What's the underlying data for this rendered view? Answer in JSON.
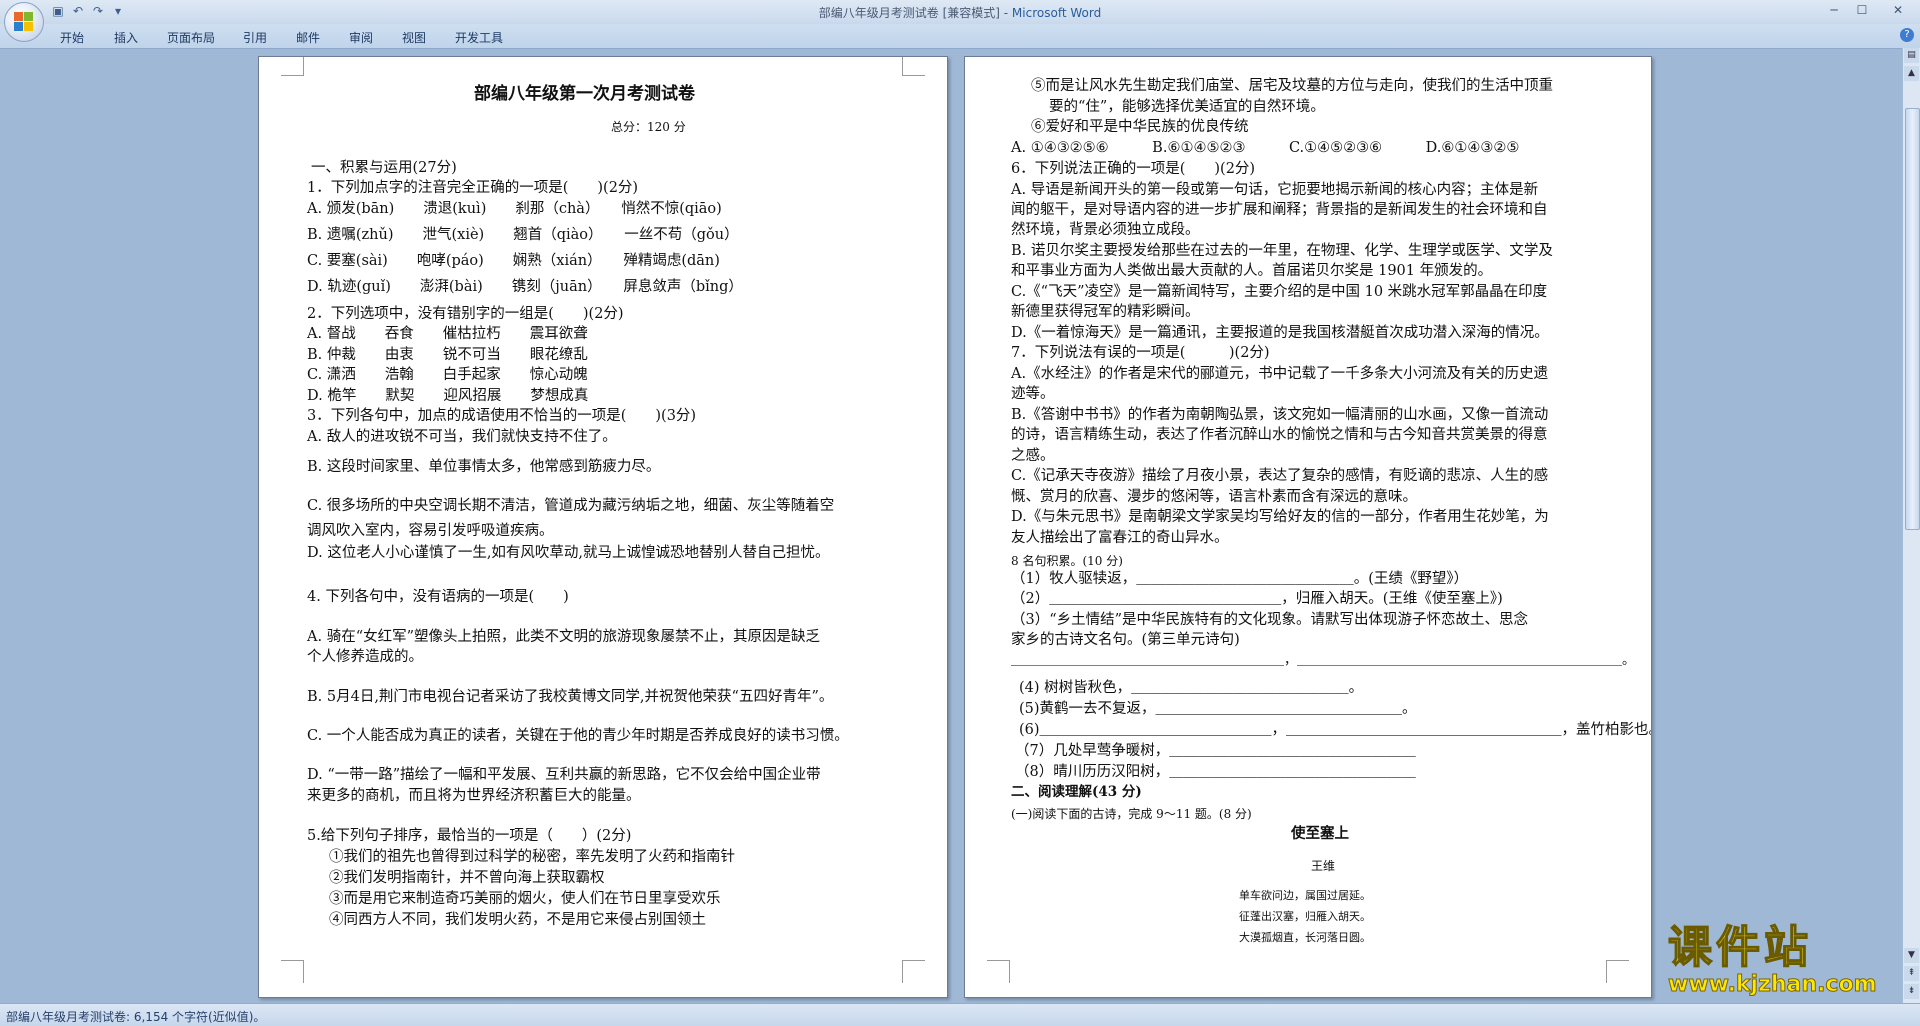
{
  "window": {
    "title_doc": "部编八年级月考测试卷 [兼容模式] - ",
    "title_app": "Microsoft Word"
  },
  "ribbon": {
    "tabs": [
      "开始",
      "插入",
      "页面布局",
      "引用",
      "邮件",
      "审阅",
      "视图",
      "开发工具"
    ]
  },
  "page1": {
    "lines": [
      "部编八年级第一次月考测试卷",
      "总分：120 分",
      "一、积累与运用(27分)",
      "1．下列加点字的注音完全正确的一项是(　　)(2分)",
      "A. 颁发(bān)　　溃退(kuì)　　刹那（chà）　　悄然不惊(qiāo)",
      "B. 遗嘱(zhǔ)　　泄气(xiè)　　翘首（qiào）　　一丝不苟（gǒu）",
      "C. 要塞(sài)　　咆哮(páo)　　娴熟（xián）　　殚精竭虑(dān)",
      "D. 轨迹(guǐ)　　澎湃(bài)　　镌刻（juān）　　屏息敛声（bǐng）",
      "2．下列选项中，没有错别字的一组是(　　)(2分)",
      "A. 督战　　吞食　　催枯拉朽　　震耳欲聋",
      "B. 仲裁　　由衷　　锐不可当　　眼花缭乱",
      "C. 潇洒　　浩翰　　白手起家　　惊心动魄",
      "D. 桅竿　　默契　　迎风招展　　梦想成真",
      "3．下列各句中，加点的成语使用不恰当的一项是(　　)(3分)",
      "A. 敌人的进攻锐不可当，我们就快支持不住了。",
      "B. 这段时间家里、单位事情太多，他常感到筋疲力尽。",
      "C. 很多场所的中央空调长期不清洁，管道成为藏污纳垢之地，细菌、灰尘等随着空",
      "调风吹入室内，容易引发呼吸道疾病。",
      "D. 这位老人小心谨慎了一生,如有风吹草动,就马上诚惶诚恐地替别人替自己担忧。",
      "4. 下列各句中，没有语病的一项是(　　)",
      "A. 骑在“女红军”塑像头上拍照，此类不文明的旅游现象屡禁不止，其原因是缺乏",
      "个人修养造成的。",
      "B. 5月4日,荆门市电视台记者采访了我校黄博文同学,并祝贺他荣获“五四好青年”。",
      "C. 一个人能否成为真正的读者，关键在于他的青少年时期是否养成良好的读书习惯。",
      "D. “一带一路”描绘了一幅和平发展、互利共赢的新思路，它不仅会给中国企业带",
      "来更多的商机，而且将为世界经济积蓄巨大的能量。",
      "5.给下列句子排序，最恰当的一项是（　　）(2分)",
      "①我们的祖先也曾得到过科学的秘密，率先发明了火药和指南针",
      "②我们发明指南针，并不曾向海上获取霸权",
      "③而是用它来制造奇巧美丽的烟火，使人们在节日里享受欢乐",
      "④同西方人不同，我们发明火药，不是用它来侵占别国领土"
    ]
  },
  "page2": {
    "lines": [
      "⑤而是让风水先生勘定我们庙堂、居宅及坟墓的方位与走向，使我们的生活中顶重",
      "要的“住”，能够选择优美适宜的自然环境。",
      "⑥爱好和平是中华民族的优良传统",
      "A. ①④③②⑤⑥　　　B.⑥①④⑤②③　　　C.①④⑤②③⑥　　　D.⑥①④③②⑤",
      "6．下列说法正确的一项是(　　)(2分)",
      "A. 导语是新闻开头的第一段或第一句话，它扼要地揭示新闻的核心内容；主体是新",
      "闻的躯干，是对导语内容的进一步扩展和阐释；背景指的是新闻发生的社会环境和自",
      "然环境，背景必须独立成段。",
      "B. 诺贝尔奖主要授发给那些在过去的一年里，在物理、化学、生理学或医学、文学及",
      "和平事业方面为人类做出最大贡献的人。首届诺贝尔奖是 1901 年颁发的。",
      "C.《“飞天”凌空》是一篇新闻特写，主要介绍的是中国 10 米跳水冠军郭晶晶在印度",
      "新德里获得冠军的精彩瞬间。",
      "D.《一着惊海天》是一篇通讯，主要报道的是我国核潜艇首次成功潜入深海的情况。",
      "7．下列说法有误的一项是(　　　)(2分)",
      "A.《水经注》的作者是宋代的郦道元，书中记载了一千多条大小河流及有关的历史遗",
      "迹等。",
      "B.《答谢中书书》的作者为南朝陶弘景，该文宛如一幅清丽的山水画，又像一首流动",
      "的诗，语言精练生动，表达了作者沉醉山水的愉悦之情和与古今知音共赏美景的得意",
      "之感。",
      "C.《记承天寺夜游》描绘了月夜小景，表达了复杂的感情，有贬谪的悲凉、人生的感",
      "慨、赏月的欣喜、漫步的悠闲等，语言朴素而含有深远的意味。",
      "D.《与朱元思书》是南朝梁文学家吴均写给好友的信的一部分，作者用生花妙笔，为",
      "友人描绘出了富春江的奇山异水。",
      "8 名句积累。(10 分)",
      "（1）牧人驱犊返，＿＿＿＿＿＿＿＿＿＿＿＿＿＿＿。(王绩《野望》）",
      "（2）＿＿＿＿＿＿＿＿＿＿＿＿＿＿＿＿，归雁入胡天。(王维《使至塞上》)",
      "（3）“乡土情结”是中华民族特有的文化现象。请默写出体现游子怀恋故土、思念",
      "家乡的古诗文名句。(第三单元诗句)",
      "＿＿＿＿＿＿＿＿＿＿＿＿＿＿＿＿＿＿＿＿＿，＿＿＿＿＿＿＿＿＿＿＿＿＿＿＿＿＿＿＿＿＿＿＿＿＿。",
      "(4) 树树皆秋色，＿＿＿＿＿＿＿＿＿＿＿＿＿＿＿。",
      "(5)黄鹤一去不复返，＿＿＿＿＿＿＿＿＿＿＿＿＿＿＿＿＿。",
      "(6)＿＿＿＿＿＿＿＿＿＿＿＿＿＿＿＿，＿＿＿＿＿＿＿＿＿＿＿＿＿＿＿＿＿＿＿，盖竹柏影也。",
      "（7）几处早莺争暖树，＿＿＿＿＿＿＿＿＿＿＿＿＿＿＿＿＿",
      "（8）晴川历历汉阳树，＿＿＿＿＿＿＿＿＿＿＿＿＿＿＿＿＿",
      "二、阅读理解(43 分)",
      "(一)阅读下面的古诗，完成 9～11 题。(8 分)",
      "使至塞上",
      "王维",
      "单车欲问边，属国过居延。",
      "征蓬出汉塞，归雁入胡天。",
      "大漠孤烟直，长河落日圆。"
    ]
  },
  "status": {
    "text": "部编八年级月考测试卷: 6,154 个字符(近似值)。"
  },
  "watermark": {
    "title": "课件站",
    "url": "www.kjzhan.com"
  },
  "colors": {
    "background": "#9eb8d6",
    "title_app": "#2a5d9c"
  }
}
